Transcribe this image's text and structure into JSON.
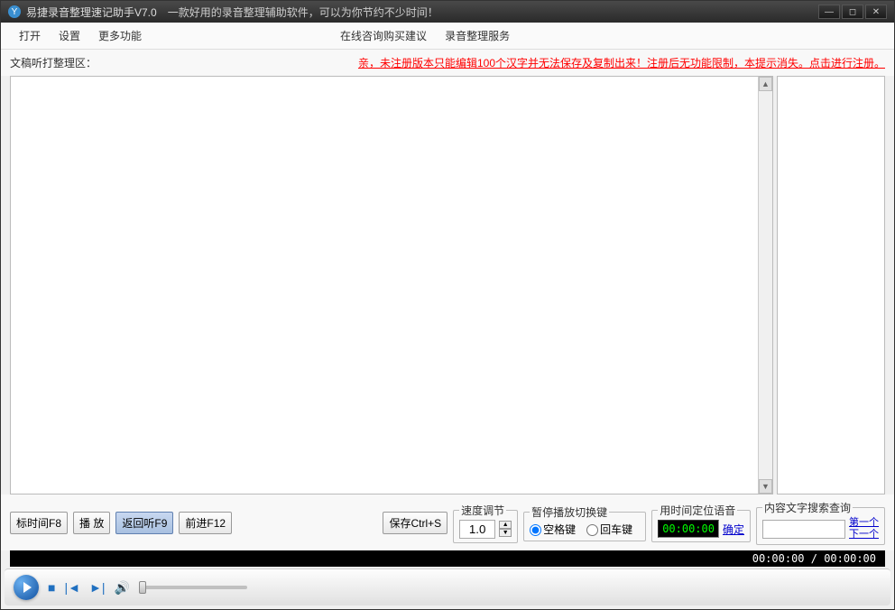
{
  "titlebar": {
    "icon_letter": "Y",
    "title": "易捷录音整理速记助手V7.0",
    "subtitle": "一款好用的录音整理辅助软件，可以为你节约不少时间！"
  },
  "menu": {
    "open": "打开",
    "settings": "设置",
    "more": "更多功能",
    "consult": "在线咨询购买建议",
    "service": "录音整理服务"
  },
  "section": {
    "label": "文稿听打整理区：",
    "warning": "亲，未注册版本只能编辑100个汉字并无法保存及复制出来！注册后无功能限制，本提示消失。点击进行注册。"
  },
  "buttons": {
    "mark_time": "标时间F8",
    "play": "播  放",
    "replay": "返回听F9",
    "forward": "前进F12",
    "save": "保存Ctrl+S"
  },
  "groups": {
    "speed": {
      "legend": "速度调节",
      "value": "1.0"
    },
    "pause": {
      "legend": "暂停播放切换键",
      "opt1": "空格键",
      "opt2": "回车键"
    },
    "timepos": {
      "legend": "用时间定位语音",
      "time": "00:00:00",
      "confirm": "确定"
    },
    "search": {
      "legend": "内容文字搜索查询",
      "first": "第一个",
      "next": "下一个"
    }
  },
  "progress": {
    "text": "00:00:00 / 00:00:00"
  },
  "scrollbar": {
    "up": "▲",
    "down": "▼"
  }
}
